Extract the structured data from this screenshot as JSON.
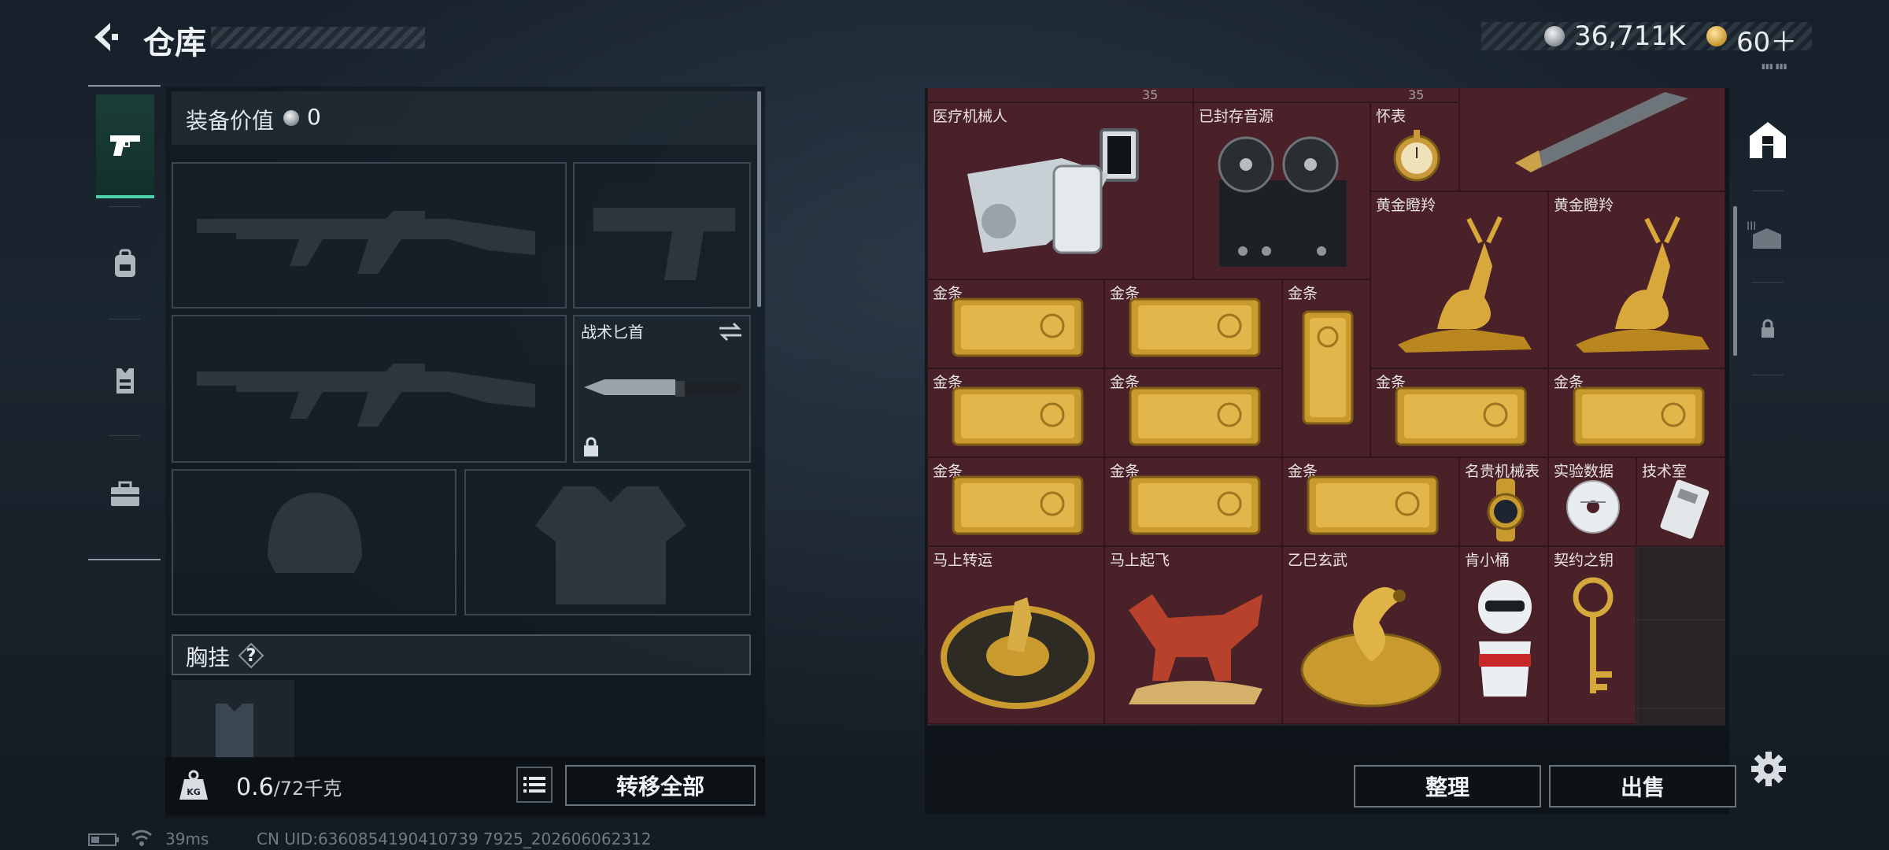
{
  "header": {
    "title": "仓库",
    "currency_primary": "36,711K",
    "currency_secondary": "60＋",
    "micro_label": "▮▮▮ ▮▮▮"
  },
  "left_nav": {
    "items": [
      "pistol-icon",
      "backpack-icon",
      "vest-icon",
      "toolbox-icon"
    ]
  },
  "loadout": {
    "value_label": "装备价值",
    "value_amount": "0",
    "melee_label": "战术匕首",
    "chest_label": "胸挂",
    "chest_help": "?"
  },
  "weight": {
    "current": "0.6",
    "capacity": "/72千克",
    "kg_badge": "KG"
  },
  "buttons": {
    "transfer_all": "转移全部",
    "sort": "整理",
    "sell": "出售"
  },
  "storage": {
    "top_strip_values": [
      "35",
      "35"
    ],
    "items": [
      {
        "label": "医疗机械人",
        "icon": "medical-robot"
      },
      {
        "label": "已封存音源",
        "icon": "tape-recorder"
      },
      {
        "label": "怀表",
        "icon": "pocket-watch"
      },
      {
        "label": "",
        "icon": "rocket-shell"
      },
      {
        "label": "黄金瞪羚",
        "icon": "golden-gazelle"
      },
      {
        "label": "黄金瞪羚",
        "icon": "golden-gazelle"
      },
      {
        "label": "金条",
        "icon": "gold-bar"
      },
      {
        "label": "金条",
        "icon": "gold-bar"
      },
      {
        "label": "金条",
        "icon": "gold-bar-vertical"
      },
      {
        "label": "金条",
        "icon": "gold-bar"
      },
      {
        "label": "金条",
        "icon": "gold-bar"
      },
      {
        "label": "金条",
        "icon": "gold-bar"
      },
      {
        "label": "金条",
        "icon": "gold-bar"
      },
      {
        "label": "金条",
        "icon": "gold-bar"
      },
      {
        "label": "金条",
        "icon": "gold-bar"
      },
      {
        "label": "金条",
        "icon": "gold-bar"
      },
      {
        "label": "名贵机械表",
        "icon": "luxury-watch"
      },
      {
        "label": "实验数据",
        "icon": "data-disc"
      },
      {
        "label": "技术室",
        "icon": "keycard"
      },
      {
        "label": "马上转运",
        "icon": "horse-medallion"
      },
      {
        "label": "马上起飞",
        "icon": "red-horse"
      },
      {
        "label": "乙巳玄武",
        "icon": "golden-dragon-turtle"
      },
      {
        "label": "肯小桶",
        "icon": "kfc-figure"
      },
      {
        "label": "契约之钥",
        "icon": "ornate-key"
      }
    ]
  },
  "status_bar": {
    "ping": "39ms",
    "uid": "CN UID:6360854190410739 7925_202606062312"
  },
  "colors": {
    "item_bg": "#4a2129",
    "grid_bg": "#2a2327",
    "accent_green": "#4fd1a8",
    "gold": "#d4a83a"
  }
}
